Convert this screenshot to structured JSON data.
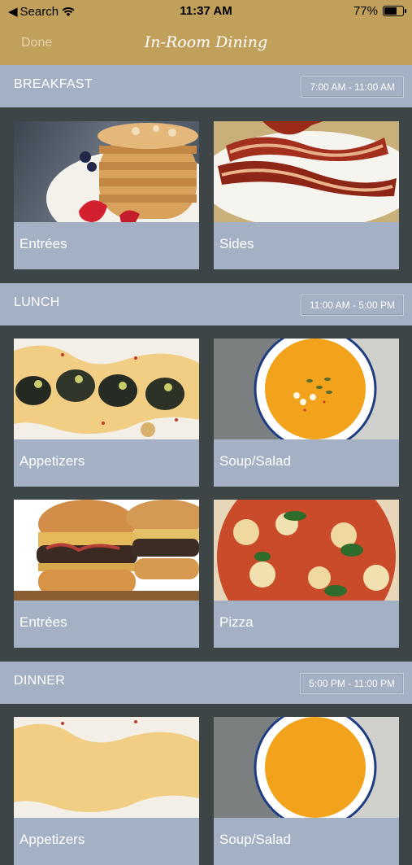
{
  "status_bar": {
    "back_app": "Search",
    "time": "11:37 AM",
    "battery_percent": "77%",
    "battery_level": 0.77
  },
  "nav": {
    "done_label": "Done",
    "title": "In-Room Dining"
  },
  "sections": [
    {
      "name": "BREAKFAST",
      "hours": "7:00 AM - 11:00 AM",
      "tiles": [
        {
          "label": "Entrées",
          "image": "pancakes-photo"
        },
        {
          "label": "Sides",
          "image": "bacon-photo"
        }
      ]
    },
    {
      "name": "LUNCH",
      "hours": "11:00 AM - 5:00 PM",
      "tiles": [
        {
          "label": "Appetizers",
          "image": "dumplings-photo"
        },
        {
          "label": "Soup/Salad",
          "image": "soup-photo"
        },
        {
          "label": "Entrées",
          "image": "burgers-photo"
        },
        {
          "label": "Pizza",
          "image": "pizza-photo"
        }
      ]
    },
    {
      "name": "DINNER",
      "hours": "5:00 PM - 11:00 PM",
      "tiles": [
        {
          "label": "Appetizers",
          "image": "dumplings-photo"
        },
        {
          "label": "Soup/Salad",
          "image": "soup-photo"
        }
      ]
    }
  ]
}
